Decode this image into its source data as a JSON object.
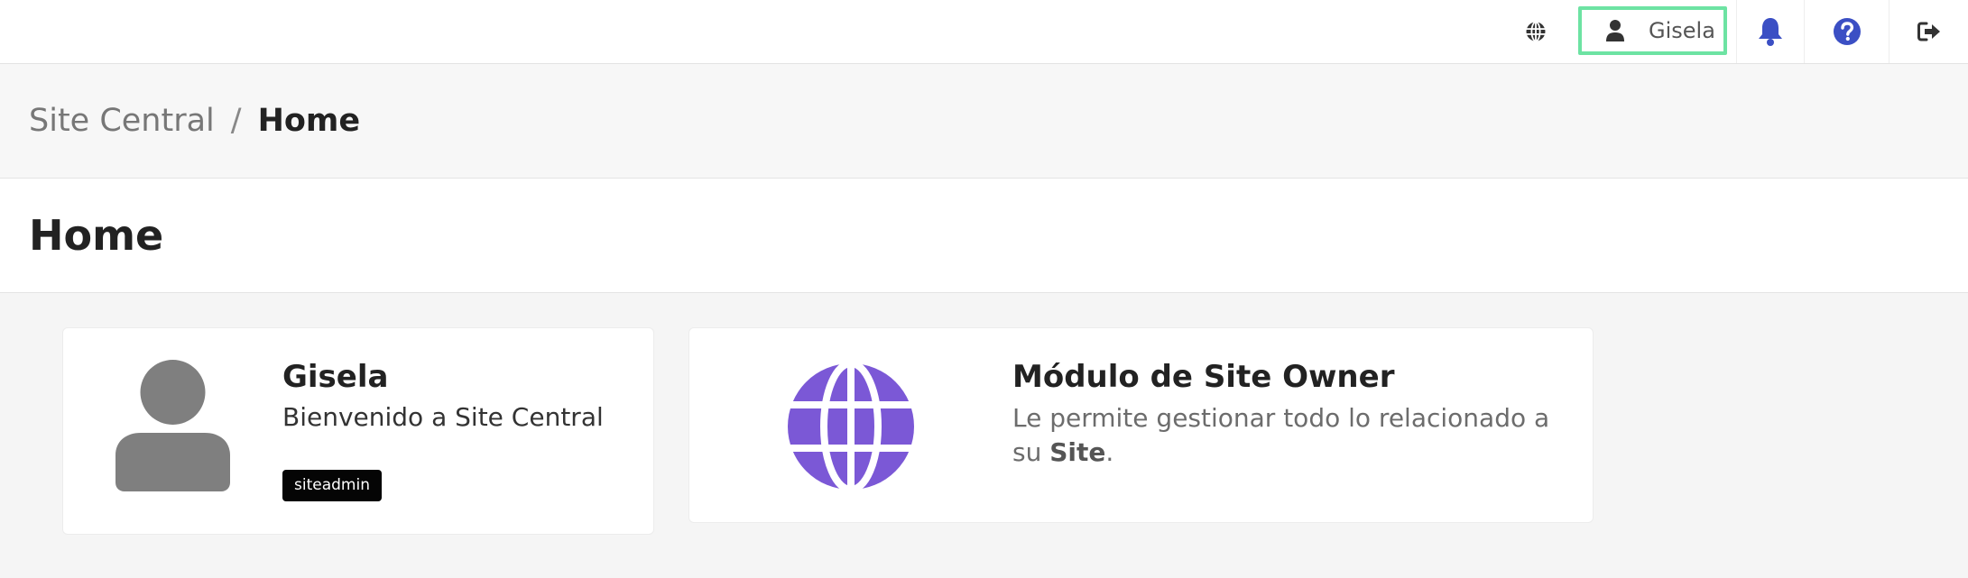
{
  "topbar": {
    "language_icon": "globe-icon",
    "user_icon": "user-icon",
    "user_name": "Gisela",
    "notifications_icon": "bell-icon",
    "help_icon": "question-circle-icon",
    "logout_icon": "sign-out-icon",
    "highlight_color": "#6de3a3",
    "accent_color": "#3b4fc4"
  },
  "breadcrumb": {
    "root": "Site Central",
    "separator": "/",
    "current": "Home"
  },
  "page": {
    "title": "Home"
  },
  "user_card": {
    "avatar_icon": "user-avatar-icon",
    "name": "Gisela",
    "welcome": "Bienvenido a Site Central",
    "role": "siteadmin"
  },
  "module_card": {
    "icon": "globe-icon",
    "icon_color": "#7b58d6",
    "title": "Módulo de Site Owner",
    "description": "Le permite gestionar todo lo relacionado a su",
    "description_strong": "Site",
    "description_end": "."
  }
}
